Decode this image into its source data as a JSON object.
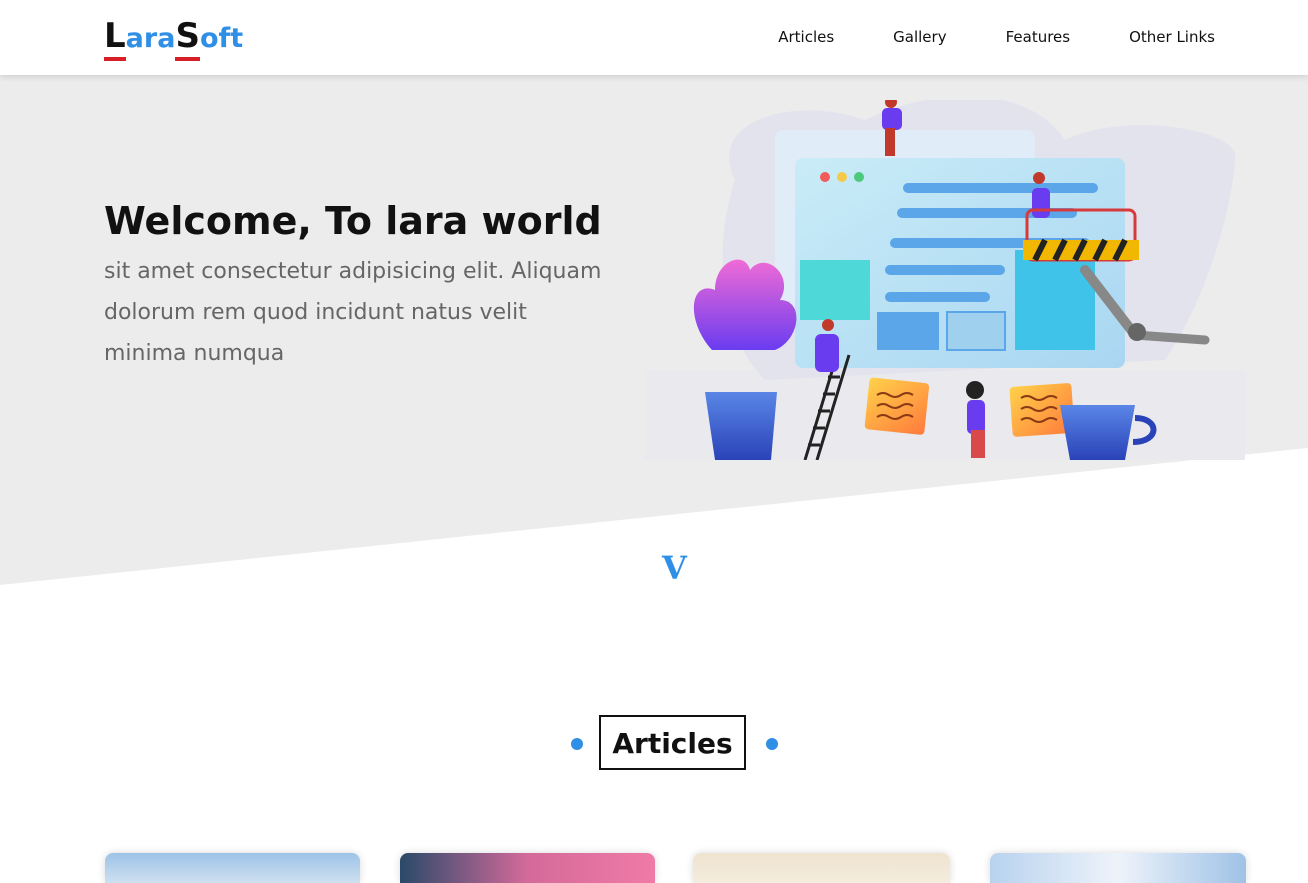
{
  "brand": {
    "letter1": "L",
    "part1": "ara",
    "letter2": "S",
    "part2": "oft"
  },
  "nav": {
    "items": [
      "Articles",
      "Gallery",
      "Features",
      "Other Links"
    ]
  },
  "hero": {
    "title": "Welcome, To lara world",
    "text": "sit amet consectetur adipisicing elit. Aliquam dolorum rem quod incidunt natus velit minima numqua"
  },
  "scroll_indicator": "V",
  "articles": {
    "title": "Articles"
  },
  "colors": {
    "accent": "#2f8fe6",
    "logo_underline": "#d61f26",
    "hero_bg": "#ececec",
    "text_dark": "#111111",
    "text_muted": "#666666"
  }
}
